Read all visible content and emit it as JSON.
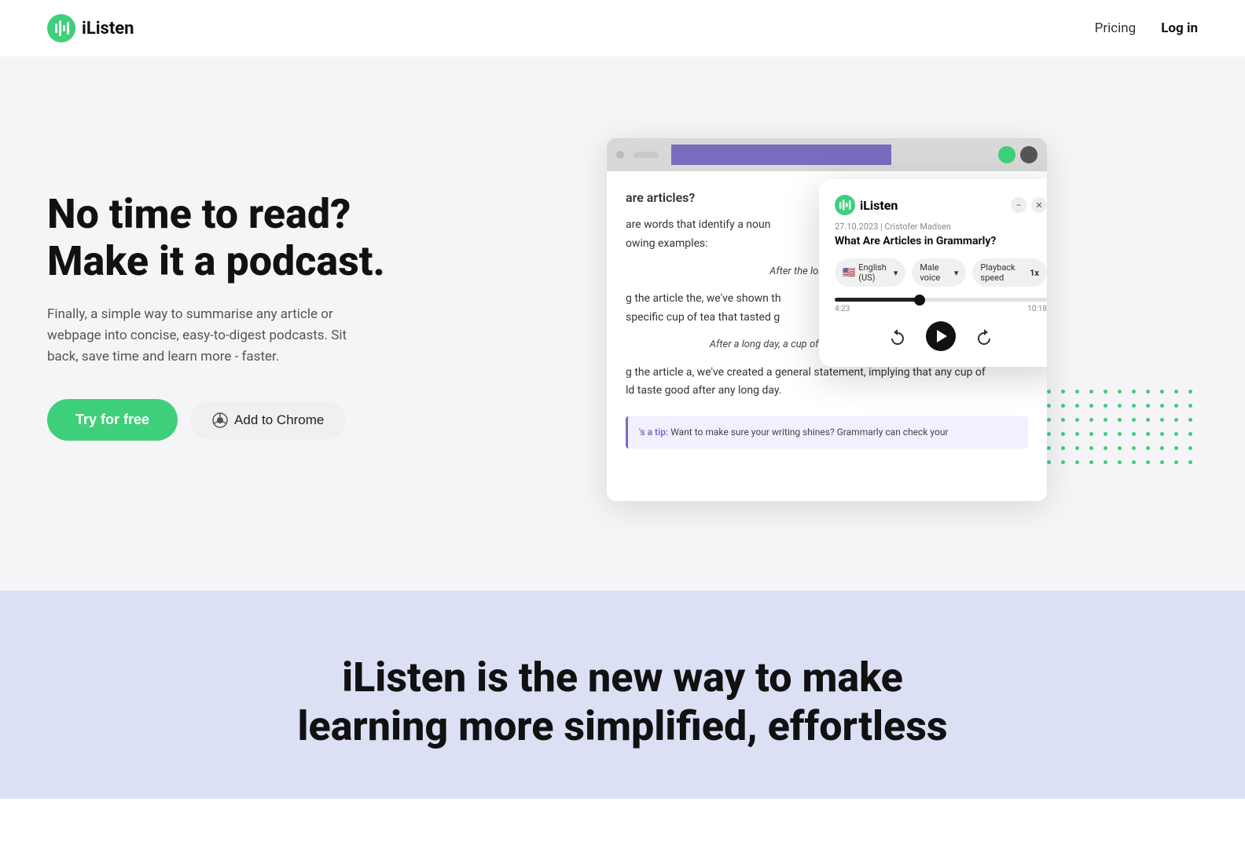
{
  "nav": {
    "logo_text": "iListen",
    "pricing_label": "Pricing",
    "login_label": "Log in"
  },
  "hero": {
    "title_line1": "No time to read?",
    "title_line2": "Make it a podcast.",
    "subtitle": "Finally, a simple way to summarise any article or webpage into concise, easy-to-digest podcasts. Sit back, save time and learn more - faster.",
    "cta_primary": "Try for free",
    "cta_secondary": "Add to Chrome"
  },
  "browser": {
    "url_tab_label": "",
    "article_heading": "are articles?",
    "article_text1": "are words that identify a noun",
    "article_text2": "owing examples:",
    "article_italic1": "After the long day, the cup",
    "article_text3": "g the article the, we've shown th",
    "article_text4": "specific cup of tea that tasted g",
    "article_italic2": "After a long day, a cup of tea tastes particularly good.",
    "article_text5": "g the article a, we've created a general statement, implying that any cup of",
    "article_text6": "ld taste good after any long day.",
    "tip_label": "'s a tip:",
    "tip_text": "Want to make sure your writing shines? Grammarly can check your"
  },
  "popup": {
    "logo_text": "iListen",
    "meta": "27.10.2023 | Cristofer Madsen",
    "title": "What Are Articles in Grammarly?",
    "language_label": "English (US)",
    "voice_label": "Male voice",
    "speed_label": "Playback speed",
    "speed_value": "1x",
    "time_current": "4:23",
    "time_total": "10:18",
    "progress_pct": 42
  },
  "bottom": {
    "title_line1": "iListen is the new way to make",
    "title_line2": "learning more simplified, effortless"
  },
  "dots": {
    "count": 90,
    "color": "#3ecf7a"
  }
}
